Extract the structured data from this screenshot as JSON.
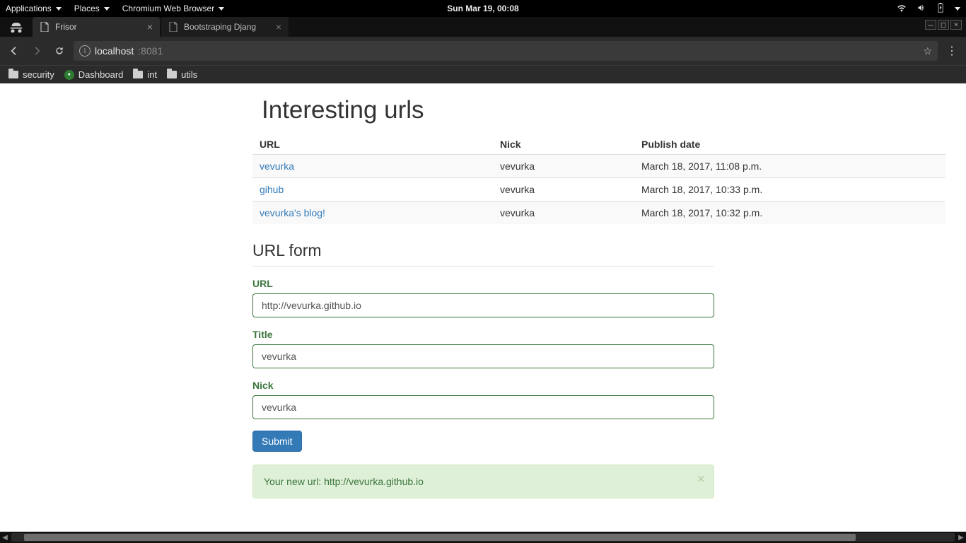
{
  "gnome": {
    "apps": "Applications",
    "places": "Places",
    "active_app": "Chromium Web Browser",
    "clock": "Sun Mar 19, 00:08"
  },
  "browser": {
    "tabs": [
      {
        "title": "Frisor"
      },
      {
        "title": "Bootstraping Djang"
      }
    ],
    "address": {
      "host": "localhost",
      "port": ":8081"
    },
    "bookmarks": [
      {
        "label": "security",
        "type": "folder"
      },
      {
        "label": "Dashboard",
        "type": "app"
      },
      {
        "label": "int",
        "type": "folder"
      },
      {
        "label": "utils",
        "type": "folder"
      }
    ]
  },
  "page": {
    "heading": "Interesting urls",
    "columns": {
      "url": "URL",
      "nick": "Nick",
      "date": "Publish date"
    },
    "rows": [
      {
        "url": "vevurka",
        "nick": "vevurka",
        "date": "March 18, 2017, 11:08 p.m."
      },
      {
        "url": "gihub",
        "nick": "vevurka",
        "date": "March 18, 2017, 10:33 p.m."
      },
      {
        "url": "vevurka's blog!",
        "nick": "vevurka",
        "date": "March 18, 2017, 10:32 p.m."
      }
    ],
    "form": {
      "title": "URL form",
      "url_label": "URL",
      "url_value": "http://vevurka.github.io",
      "title_label": "Title",
      "title_value": "vevurka",
      "nick_label": "Nick",
      "nick_value": "vevurka",
      "submit": "Submit"
    },
    "alert": "Your new url: http://vevurka.github.io"
  }
}
